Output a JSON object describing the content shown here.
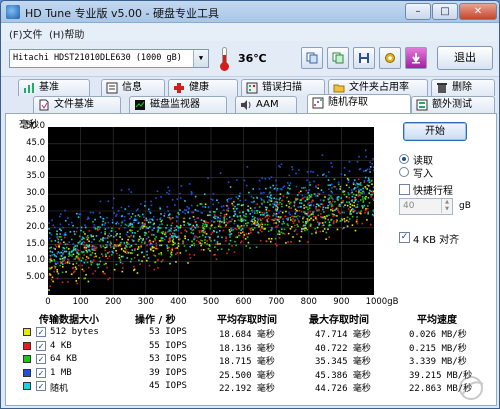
{
  "window": {
    "title": "HD Tune 专业版 v5.00 - 硬盘专业工具",
    "controls": {
      "minimize": "–",
      "maximize": "□",
      "close": "✕"
    }
  },
  "menu": {
    "file": "(F)文件",
    "help": "(H)帮助"
  },
  "toolbar": {
    "drive": "Hitachi HDST21010DLE630 (1000 gB)",
    "temperature": "36℃",
    "exit_label": "退出",
    "icons": [
      "copy-icon",
      "copy-all-icon",
      "save-icon",
      "options-icon",
      "download-icon"
    ]
  },
  "tabs_row1": [
    {
      "label": "基准",
      "icon": "benchmark-icon"
    },
    {
      "label": "信息",
      "icon": "info-icon"
    },
    {
      "label": "健康",
      "icon": "health-icon"
    },
    {
      "label": "错误扫描",
      "icon": "error-scan-icon"
    },
    {
      "label": "文件夹占用率",
      "icon": "folder-usage-icon"
    },
    {
      "label": "删除",
      "icon": "erase-icon"
    }
  ],
  "tabs_row2": [
    {
      "label": "文件基准",
      "icon": "file-benchmark-icon"
    },
    {
      "label": "磁盘监视器",
      "icon": "disk-monitor-icon"
    },
    {
      "label": "AAM",
      "icon": "aam-icon"
    },
    {
      "label": "随机存取",
      "icon": "random-access-icon",
      "active": true
    },
    {
      "label": "额外测试",
      "icon": "extra-tests-icon"
    }
  ],
  "chart_data": {
    "type": "scatter",
    "ylabel": "毫秒",
    "xlabel": "gB",
    "xlim": [
      0,
      1000
    ],
    "ylim": [
      0,
      50
    ],
    "x_ticks": [
      "0",
      "100",
      "200",
      "300",
      "400",
      "500",
      "600",
      "700",
      "800",
      "900",
      "1000gB"
    ],
    "y_ticks": [
      "50.0",
      "45.0",
      "40.0",
      "35.0",
      "30.0",
      "25.0",
      "20.0",
      "15.0",
      "10.0",
      "5.00"
    ],
    "grid": true,
    "series": [
      {
        "name": "512 bytes",
        "color": "#e8e800",
        "trend_start": 10,
        "trend_end": 28,
        "spread": 9
      },
      {
        "name": "4 KB",
        "color": "#e02020",
        "trend_start": 10,
        "trend_end": 28,
        "spread": 9
      },
      {
        "name": "64 KB",
        "color": "#20c020",
        "trend_start": 11,
        "trend_end": 29,
        "spread": 9
      },
      {
        "name": "1 MB",
        "color": "#2050e0",
        "trend_start": 18,
        "trend_end": 35,
        "spread": 11
      },
      {
        "name": "随机",
        "color": "#20d0e0",
        "trend_start": 14,
        "trend_end": 31,
        "spread": 10
      }
    ]
  },
  "controls": {
    "start": "开始",
    "read": "读取",
    "write": "写入",
    "quick_test": "快捷行程",
    "quick_value": "40",
    "quick_unit": "gB",
    "align": "4 KB 对齐"
  },
  "table": {
    "headers": [
      "传输数据大小",
      "操作 / 秒",
      "平均存取时间",
      "最大存取时间",
      "平均速度"
    ],
    "rows": [
      {
        "size": "512 bytes",
        "color": "#e8e800",
        "ops": "53 IOPS",
        "avg": "18.684 毫秒",
        "max": "47.714 毫秒",
        "speed": "0.026 MB/秒"
      },
      {
        "size": "4 KB",
        "color": "#e02020",
        "ops": "55 IOPS",
        "avg": "18.136 毫秒",
        "max": "40.722 毫秒",
        "speed": "0.215 MB/秒"
      },
      {
        "size": "64 KB",
        "color": "#20c020",
        "ops": "53 IOPS",
        "avg": "18.715 毫秒",
        "max": "35.345 毫秒",
        "speed": "3.339 MB/秒"
      },
      {
        "size": "1 MB",
        "color": "#2050e0",
        "ops": "39 IOPS",
        "avg": "25.500 毫秒",
        "max": "45.386 毫秒",
        "speed": "39.215 MB/秒"
      },
      {
        "size": "随机",
        "color": "#20d0e0",
        "ops": "45 IOPS",
        "avg": "22.192 毫秒",
        "max": "44.726 毫秒",
        "speed": "22.863 MB/秒"
      }
    ]
  }
}
